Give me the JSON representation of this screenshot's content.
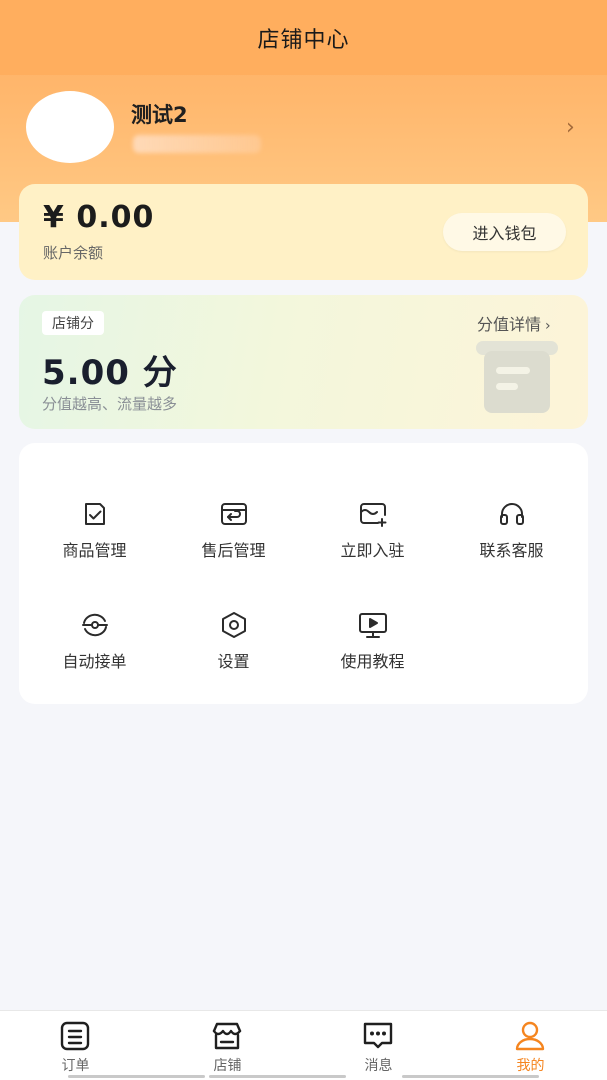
{
  "header": {
    "title": "店铺中心"
  },
  "profile": {
    "username": "测试2",
    "chevron": "›"
  },
  "wallet": {
    "amount": "¥ 0.00",
    "label": "账户余额",
    "button_label": "进入钱包"
  },
  "score": {
    "tag": "店铺分",
    "detail_label": "分值详情",
    "detail_chevron": "›",
    "value": "5.00 分",
    "hint": "分值越高、流量越多"
  },
  "menu": {
    "items": [
      {
        "label": "商品管理",
        "icon": "clipboard-check-icon"
      },
      {
        "label": "售后管理",
        "icon": "return-box-icon"
      },
      {
        "label": "立即入驻",
        "icon": "add-store-icon"
      },
      {
        "label": "联系客服",
        "icon": "headset-icon"
      },
      {
        "label": "自动接单",
        "icon": "auto-eye-icon"
      },
      {
        "label": "设置",
        "icon": "hexagon-gear-icon"
      },
      {
        "label": "使用教程",
        "icon": "video-tutorial-icon"
      }
    ]
  },
  "tabbar": {
    "tabs": [
      {
        "label": "订单",
        "icon": "order-list-icon",
        "active": false
      },
      {
        "label": "店铺",
        "icon": "storefront-icon",
        "active": false
      },
      {
        "label": "消息",
        "icon": "message-icon",
        "active": false
      },
      {
        "label": "我的",
        "icon": "user-icon",
        "active": true
      }
    ]
  },
  "colors": {
    "accent": "#f5851f",
    "hero": "#ffae5e",
    "wallet_card": "#fff1c6"
  }
}
